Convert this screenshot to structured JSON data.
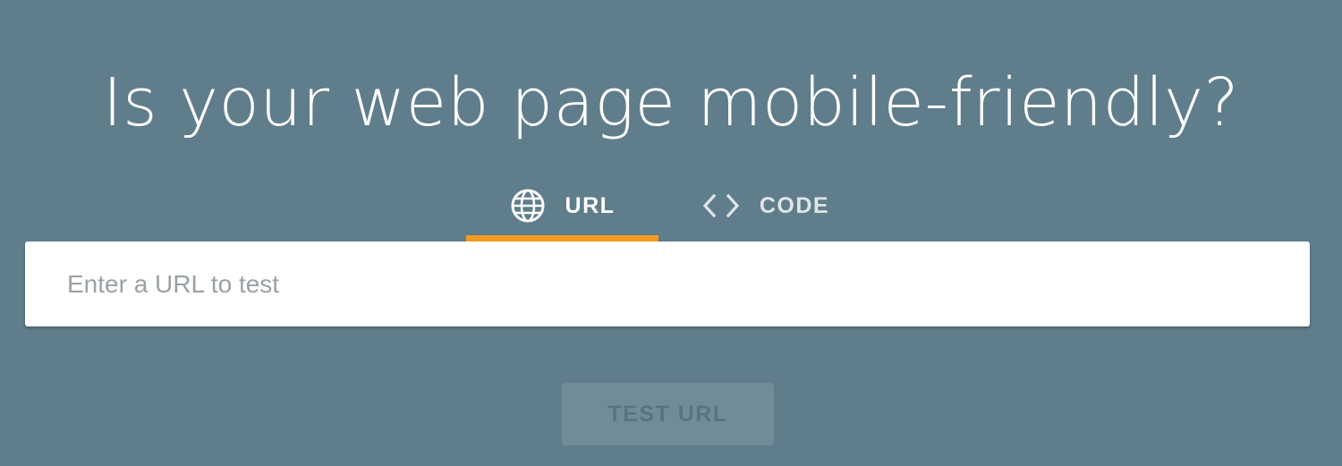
{
  "header": {
    "title": "Is your web page mobile-friendly?"
  },
  "tabs": [
    {
      "label": "URL",
      "icon": "globe-icon",
      "active": true
    },
    {
      "label": "CODE",
      "icon": "code-brackets-icon",
      "active": false
    }
  ],
  "url_input": {
    "value": "",
    "placeholder": "Enter a URL to test"
  },
  "actions": {
    "test_label": "TEST URL"
  },
  "colors": {
    "background": "#607d8b",
    "active_tab_indicator": "#f59b22",
    "button_background": "#718c98",
    "button_text": "#5a7380",
    "placeholder": "#9aa1a6"
  }
}
